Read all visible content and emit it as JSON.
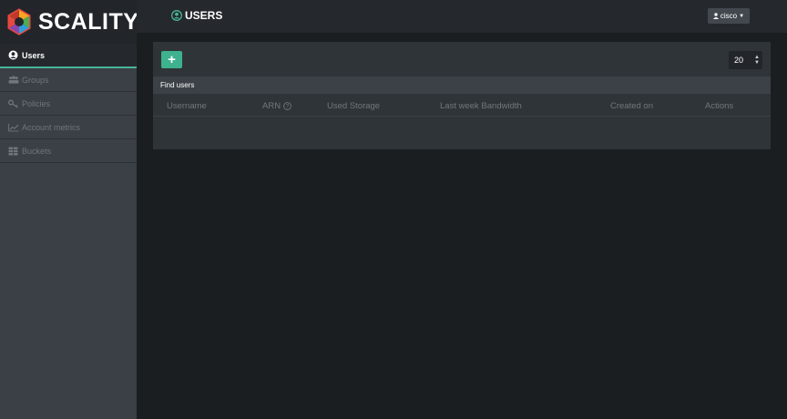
{
  "brand": {
    "name": "SCALITY"
  },
  "sidebar": {
    "items": [
      {
        "label": "Users",
        "icon": "user-circle-icon",
        "active": true
      },
      {
        "label": "Groups",
        "icon": "users-icon",
        "active": false
      },
      {
        "label": "Policies",
        "icon": "key-icon",
        "active": false
      },
      {
        "label": "Account metrics",
        "icon": "line-chart-icon",
        "active": false
      },
      {
        "label": "Buckets",
        "icon": "bucket-icon",
        "active": false
      }
    ]
  },
  "header": {
    "title": "USERS",
    "title_icon": "user-circle-icon",
    "user_menu_label": "cisco"
  },
  "toolbar": {
    "add_label": "+",
    "page_size": "20"
  },
  "search": {
    "label": "Find users"
  },
  "table": {
    "columns": [
      "Username",
      "ARN",
      "Used Storage",
      "Last week Bandwidth",
      "Created on",
      "Actions"
    ],
    "rows": []
  },
  "colors": {
    "accent": "#3eb18e",
    "sidebar_bg": "#3a4045",
    "content_bg": "#1b1e21",
    "header_bg": "#25292d"
  }
}
